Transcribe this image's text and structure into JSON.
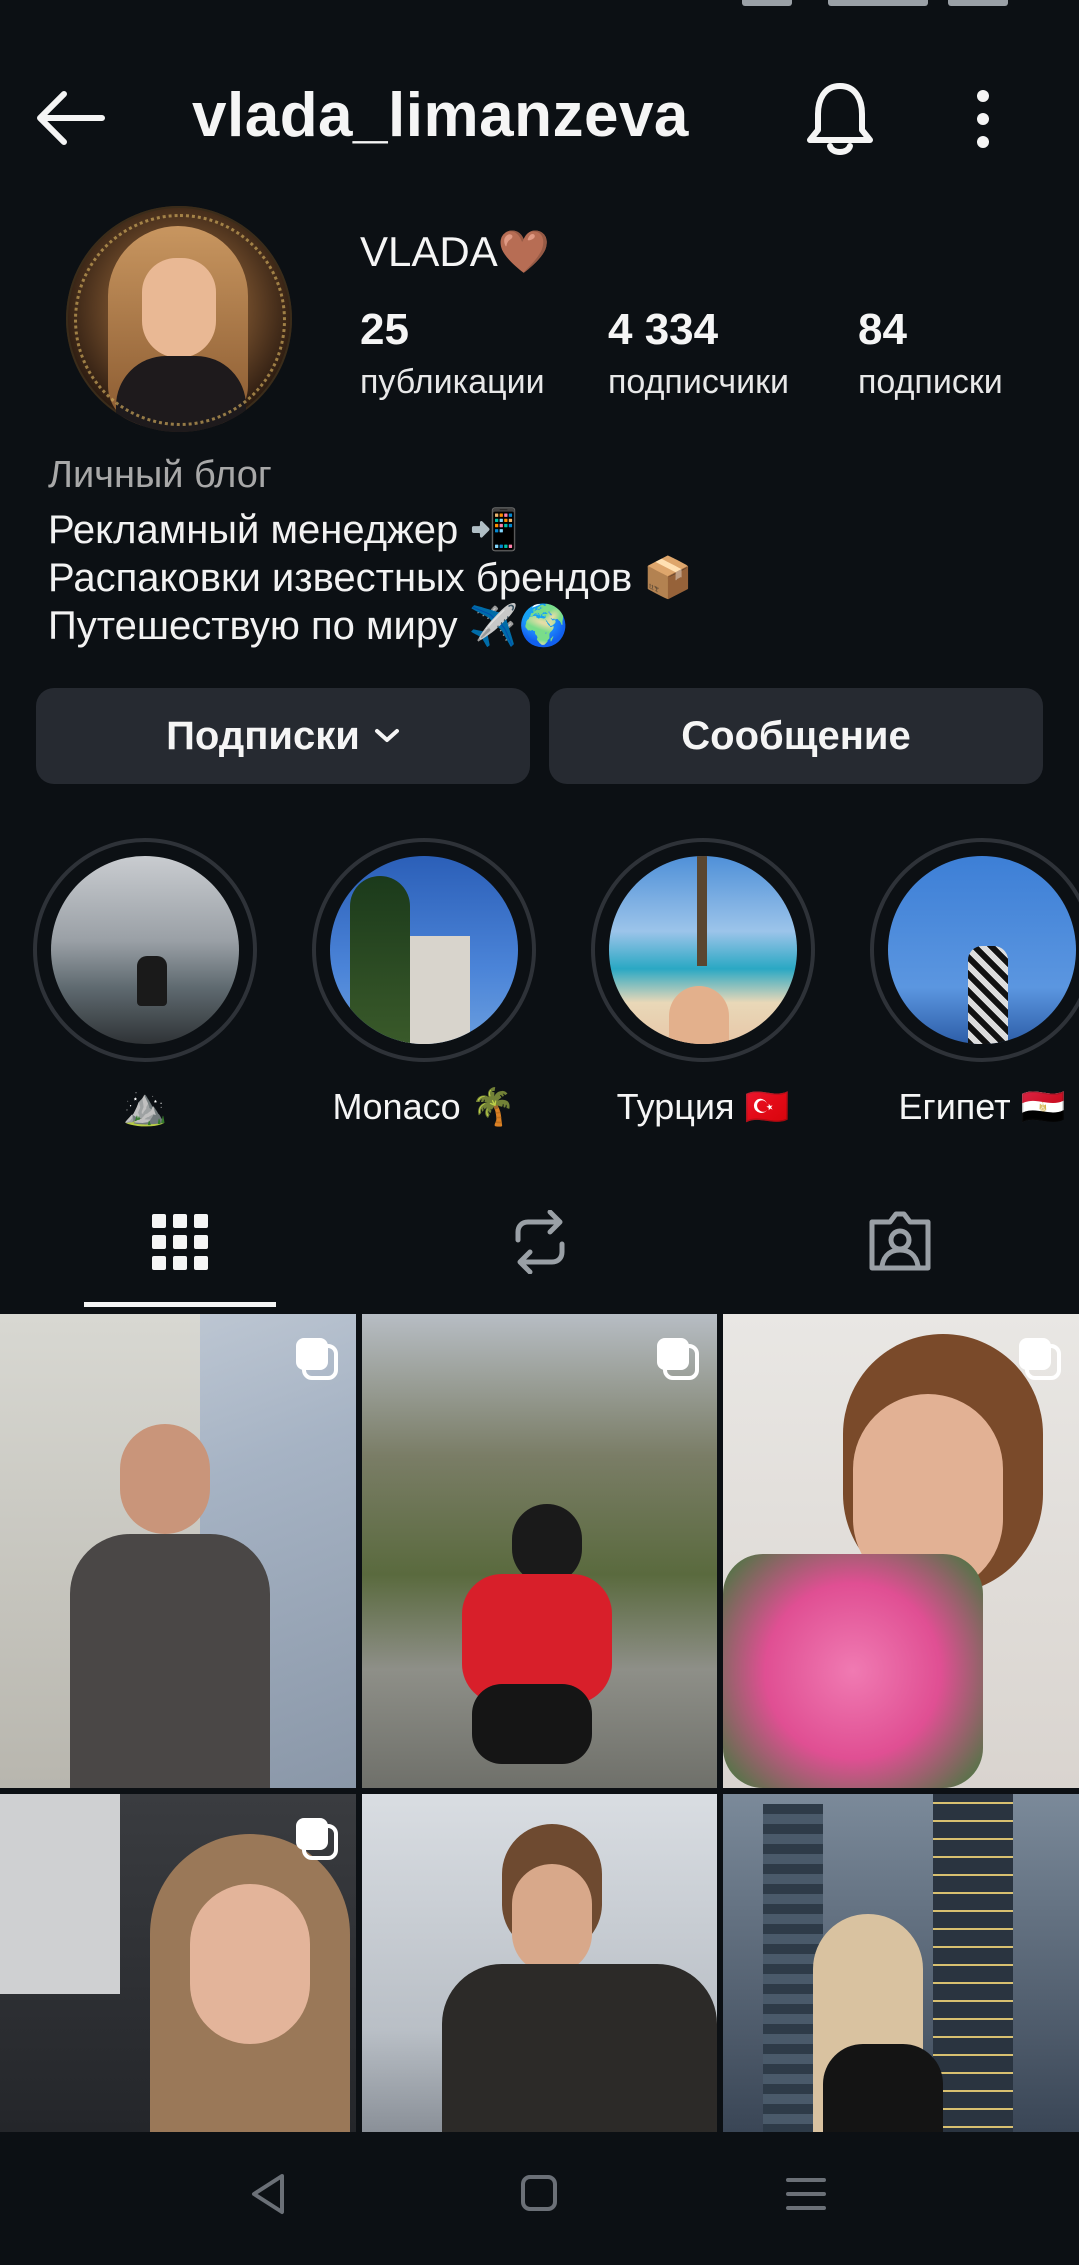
{
  "profile": {
    "username": "vlada_limanzeva",
    "display_name": "VLADA🤎",
    "stats": [
      {
        "value": "25",
        "label": "публикации"
      },
      {
        "value": "4 334",
        "label": "подписчики"
      },
      {
        "value": "84",
        "label": "подписки"
      }
    ],
    "category": "Личный блог",
    "bio": [
      "Рекламный менеджер 📲",
      "Распаковки известных брендов 📦",
      "Путешествую по миру ✈️🌍"
    ]
  },
  "buttons": {
    "following": "Подписки",
    "message": "Сообщение"
  },
  "highlights": [
    {
      "label": "⛰️"
    },
    {
      "label": "Monaco 🌴"
    },
    {
      "label": "Турция 🇹🇷"
    },
    {
      "label": "Египет 🇪🇬"
    }
  ],
  "tabs": [
    {
      "icon": "grid-icon",
      "active": true
    },
    {
      "icon": "reels-repost-icon",
      "active": false
    },
    {
      "icon": "tagged-icon",
      "active": false
    }
  ],
  "posts": [
    {
      "multi": true
    },
    {
      "multi": true
    },
    {
      "multi": true
    },
    {
      "multi": true
    },
    {
      "multi": false
    },
    {
      "multi": false
    }
  ],
  "colors": {
    "background": "#0c1014",
    "button": "#262a31",
    "secondary_text": "#a8a8a8"
  }
}
